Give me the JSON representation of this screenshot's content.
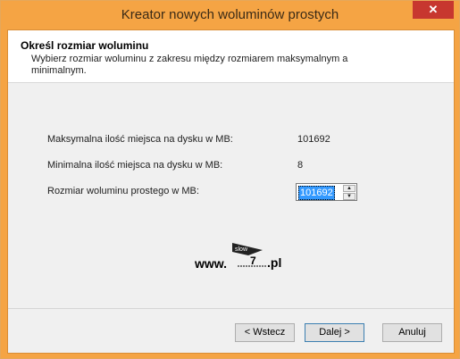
{
  "window": {
    "title": "Kreator nowych woluminów prostych",
    "close_label": "✕"
  },
  "header": {
    "title": "Określ rozmiar woluminu",
    "description": "Wybierz rozmiar woluminu z zakresu między rozmiarem maksymalnym a minimalnym."
  },
  "fields": {
    "max_label": "Maksymalna ilość miejsca na dysku w MB:",
    "max_value": "101692",
    "min_label": "Minimalna ilość miejsca na dysku w MB:",
    "min_value": "8",
    "size_label": "Rozmiar woluminu prostego w MB:",
    "size_value": "101692"
  },
  "watermark": {
    "www": "www.",
    "badge_top": "slow",
    "badge_num": "7",
    "suffix": ".pl"
  },
  "buttons": {
    "back": "< Wstecz",
    "next": "Dalej >",
    "cancel": "Anuluj"
  },
  "icons": {
    "spin_up": "spin-up-icon",
    "spin_down": "spin-down-icon",
    "close": "close-icon"
  }
}
